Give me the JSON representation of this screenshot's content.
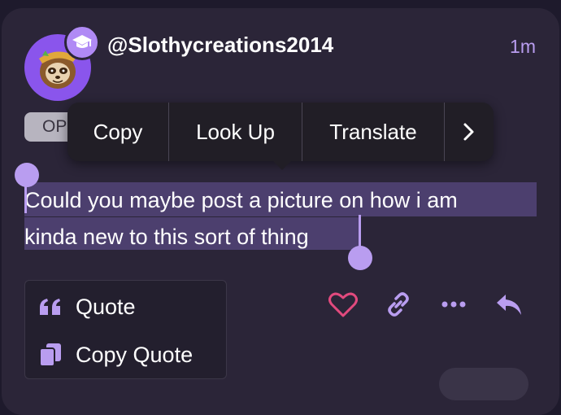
{
  "post": {
    "username": "@Slothycreations2014",
    "timestamp": "1m",
    "tag": "OP",
    "body_line1": "Could you maybe post a picture on how i am",
    "body_line2": "kinda new to this sort of thing"
  },
  "context_menu": {
    "items": [
      "Copy",
      "Look Up",
      "Translate"
    ],
    "more_icon": "chevron-right-icon"
  },
  "quote_popup": {
    "quote_label": "Quote",
    "copy_quote_label": "Copy Quote"
  },
  "actions": [
    "heart-icon",
    "link-icon",
    "more-icon",
    "reply-icon"
  ],
  "colors": {
    "background": "#1e1a2c",
    "card": "#2b2538",
    "accent": "#b99df0",
    "selection": "#4c3f6e",
    "heart": "#e24a7e"
  }
}
